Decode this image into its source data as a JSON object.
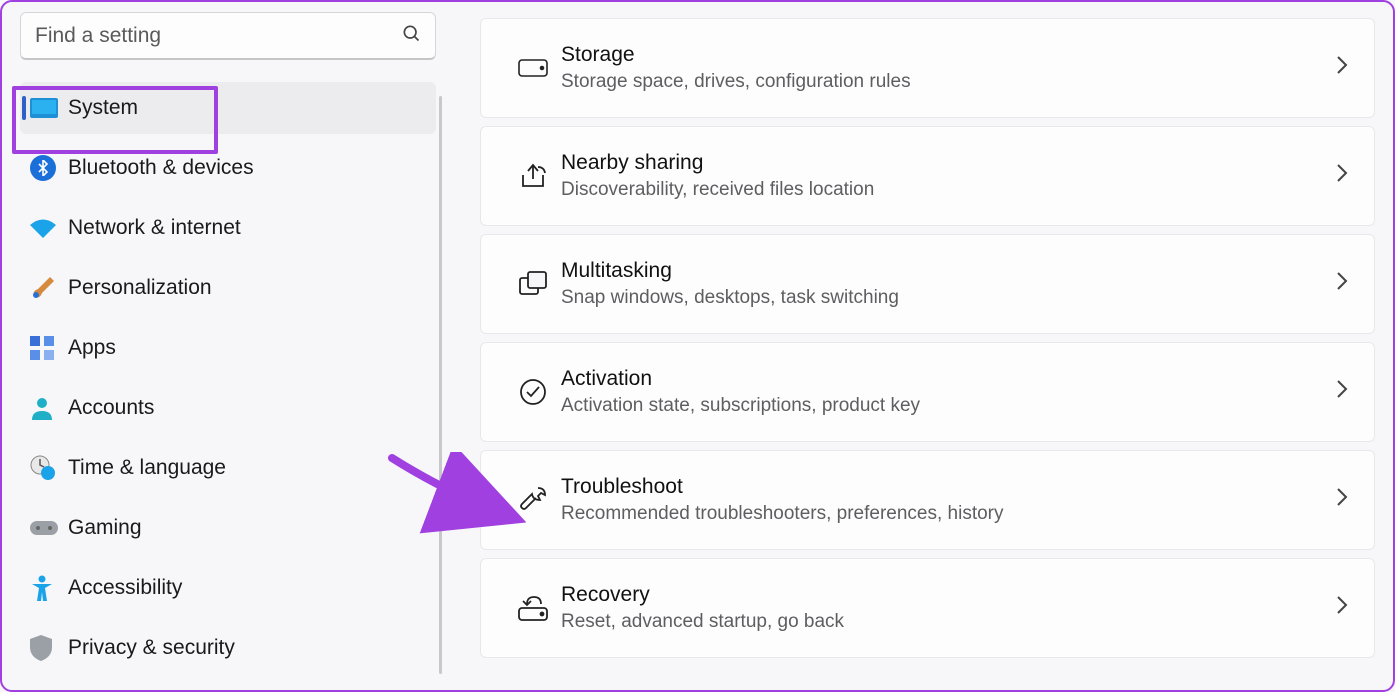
{
  "search": {
    "placeholder": "Find a setting"
  },
  "sidebar": {
    "items": [
      {
        "label": "System",
        "icon": "system",
        "active": true
      },
      {
        "label": "Bluetooth & devices",
        "icon": "bluetooth",
        "active": false
      },
      {
        "label": "Network & internet",
        "icon": "wifi",
        "active": false
      },
      {
        "label": "Personalization",
        "icon": "brush",
        "active": false
      },
      {
        "label": "Apps",
        "icon": "apps",
        "active": false
      },
      {
        "label": "Accounts",
        "icon": "person",
        "active": false
      },
      {
        "label": "Time & language",
        "icon": "clock-globe",
        "active": false
      },
      {
        "label": "Gaming",
        "icon": "gamepad",
        "active": false
      },
      {
        "label": "Accessibility",
        "icon": "accessibility",
        "active": false
      },
      {
        "label": "Privacy & security",
        "icon": "shield",
        "active": false
      }
    ]
  },
  "cards": [
    {
      "title": "Storage",
      "subtitle": "Storage space, drives, configuration rules",
      "icon": "storage"
    },
    {
      "title": "Nearby sharing",
      "subtitle": "Discoverability, received files location",
      "icon": "share"
    },
    {
      "title": "Multitasking",
      "subtitle": "Snap windows, desktops, task switching",
      "icon": "multitask"
    },
    {
      "title": "Activation",
      "subtitle": "Activation state, subscriptions, product key",
      "icon": "activation"
    },
    {
      "title": "Troubleshoot",
      "subtitle": "Recommended troubleshooters, preferences, history",
      "icon": "wrench"
    },
    {
      "title": "Recovery",
      "subtitle": "Reset, advanced startup, go back",
      "icon": "recovery"
    }
  ]
}
